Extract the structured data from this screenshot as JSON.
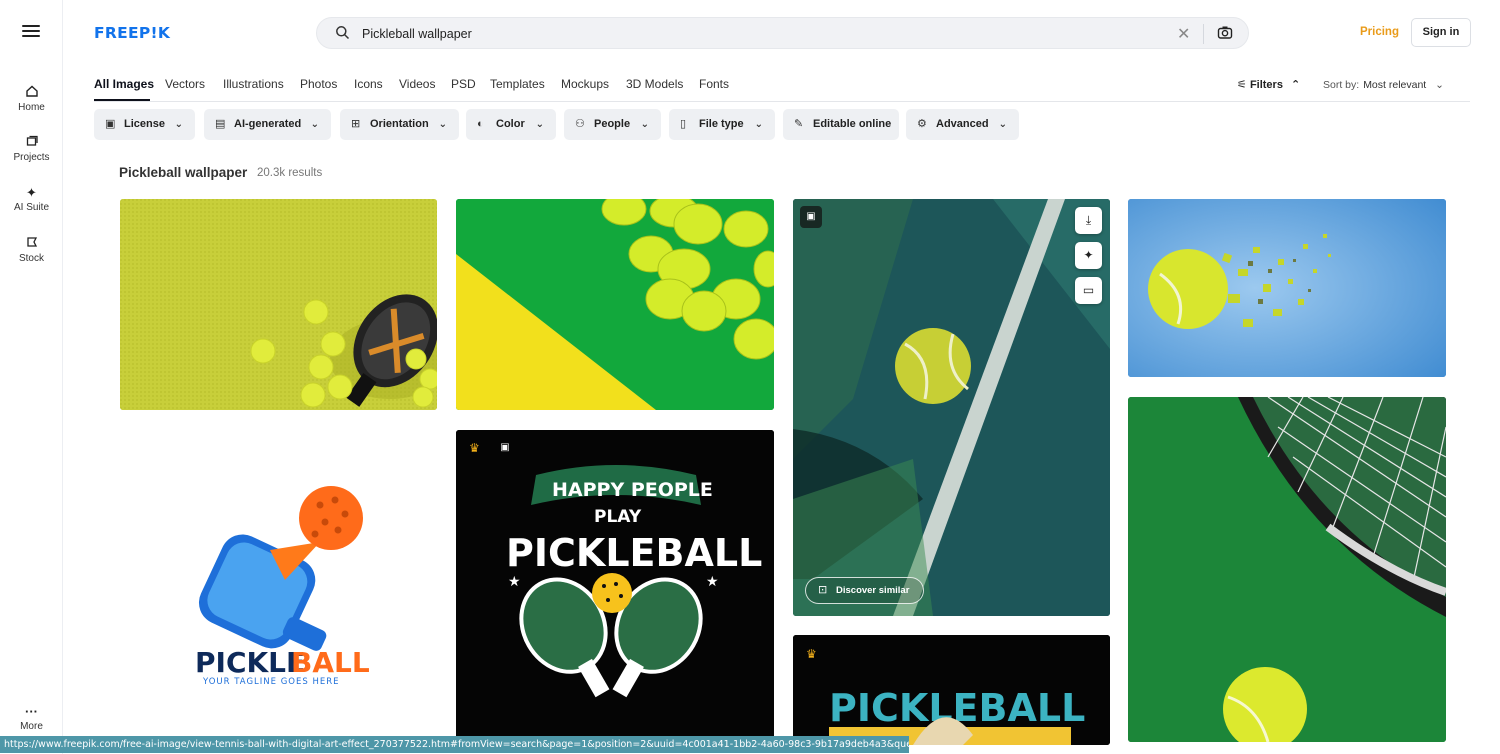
{
  "brand": {
    "logo_text": "FREEP!K",
    "logo_color": "#1273eb"
  },
  "sidebar": {
    "items": [
      {
        "label": "Home",
        "icon": "home-icon"
      },
      {
        "label": "Projects",
        "icon": "folder-icon"
      },
      {
        "label": "AI Suite",
        "icon": "sparkle-icon"
      },
      {
        "label": "Stock",
        "icon": "stock-icon"
      }
    ],
    "more_label": "More"
  },
  "search": {
    "value": "Pickleball wallpaper"
  },
  "header": {
    "pricing_label": "Pricing",
    "signin_label": "Sign in",
    "pricing_color": "#e99b1a"
  },
  "tabs": [
    {
      "label": "All Images",
      "active": true
    },
    {
      "label": "Vectors"
    },
    {
      "label": "Illustrations"
    },
    {
      "label": "Photos"
    },
    {
      "label": "Icons"
    },
    {
      "label": "Videos"
    },
    {
      "label": "PSD"
    },
    {
      "label": "Templates"
    },
    {
      "label": "Mockups"
    },
    {
      "label": "3D Models"
    },
    {
      "label": "Fonts"
    }
  ],
  "toolbar": {
    "filters_label": "Filters",
    "sort_prefix": "Sort by:",
    "sort_value": "Most relevant"
  },
  "chips": [
    {
      "label": "License",
      "icon": "license-icon"
    },
    {
      "label": "AI-generated",
      "icon": "ai-icon"
    },
    {
      "label": "Orientation",
      "icon": "orientation-icon"
    },
    {
      "label": "Color",
      "icon": "palette-icon"
    },
    {
      "label": "People",
      "icon": "people-icon"
    },
    {
      "label": "File type",
      "icon": "file-icon"
    },
    {
      "label": "Editable online",
      "icon": "pen-icon"
    },
    {
      "label": "Advanced",
      "icon": "gear-icon"
    }
  ],
  "results": {
    "title": "Pickleball wallpaper",
    "count": "20.3k results"
  },
  "cards": {
    "logo_title_a": "PICKLE",
    "logo_title_b": "BALL",
    "logo_tagline": "YOUR TAGLINE GOES HERE",
    "poster_top": "HAPPY PEOPLE",
    "poster_mid": "PLAY",
    "poster_main": "PICKLEBALL",
    "poster2_main": "PICKLEBALL",
    "discover_label": "Discover similar"
  },
  "status_url": "https://www.freepik.com/free-ai-image/view-tennis-ball-with-digital-art-effect_270377522.htm#fromView=search&page=1&position=2&uuid=4c001a41-1bb2-4a60-98c3-9b17a9deb4a3&query=Pickleball+wallpaper"
}
